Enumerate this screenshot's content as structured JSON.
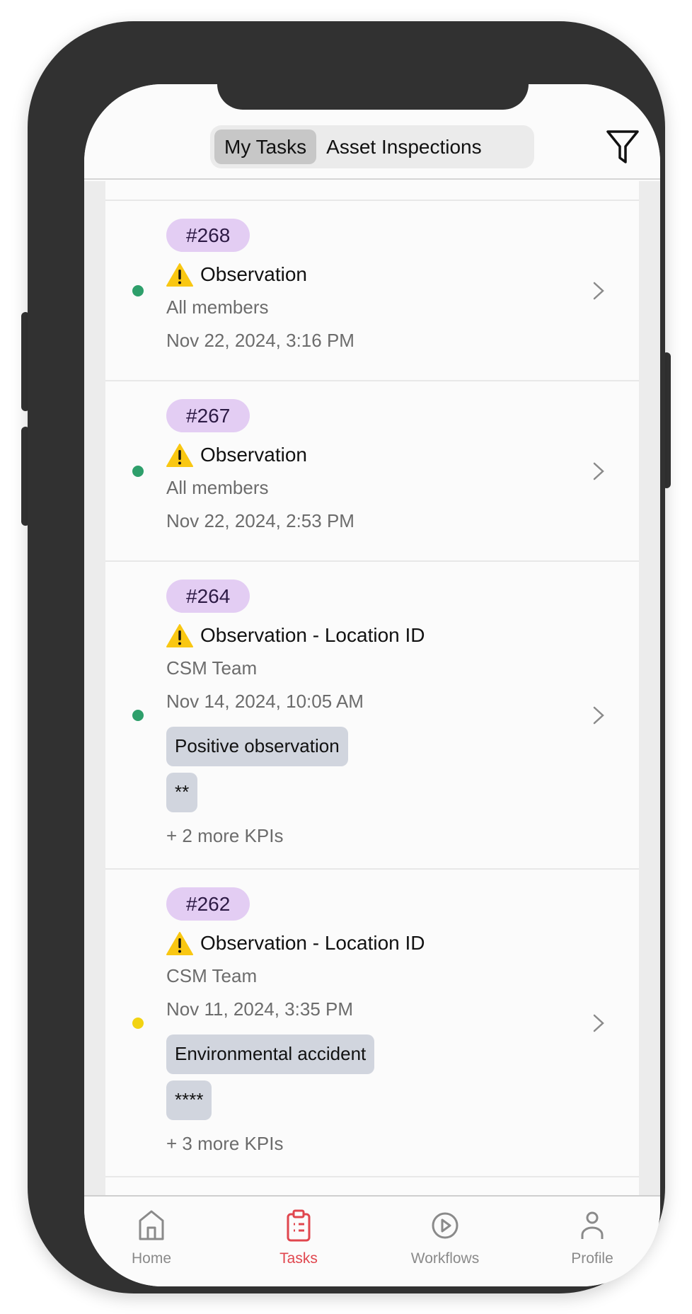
{
  "header": {
    "tabs": [
      {
        "label": "My Tasks",
        "active": true
      },
      {
        "label": "Asset Inspections",
        "active": false
      }
    ],
    "filter_icon": "filter-icon"
  },
  "tasks": [
    {
      "id": "#268",
      "title": "Observation",
      "assignee": "All members",
      "date": "Nov 22, 2024, 3:16 PM",
      "status_color": "#2e9f6b"
    },
    {
      "id": "#267",
      "title": "Observation",
      "assignee": "All members",
      "date": "Nov 22, 2024, 2:53 PM",
      "status_color": "#2e9f6b"
    },
    {
      "id": "#264",
      "title": "Observation - Location ID",
      "assignee": "CSM Team",
      "date": "Nov 14, 2024, 10:05 AM",
      "status_color": "#2e9f6b",
      "kpis": [
        "Positive observation",
        "**"
      ],
      "more": "+ 2 more KPIs"
    },
    {
      "id": "#262",
      "title": "Observation - Location ID",
      "assignee": "CSM Team",
      "date": "Nov 11, 2024, 3:35 PM",
      "status_color": "#f2d312",
      "kpis": [
        "Environmental accident",
        "****"
      ],
      "more": "+ 3 more KPIs"
    }
  ],
  "tabbar": {
    "items": [
      {
        "label": "Home",
        "icon": "home-icon"
      },
      {
        "label": "Tasks",
        "icon": "clipboard-icon",
        "active": true
      },
      {
        "label": "Workflows",
        "icon": "play-circle-icon"
      },
      {
        "label": "Profile",
        "icon": "user-icon"
      }
    ],
    "active_color": "#e0464e"
  }
}
